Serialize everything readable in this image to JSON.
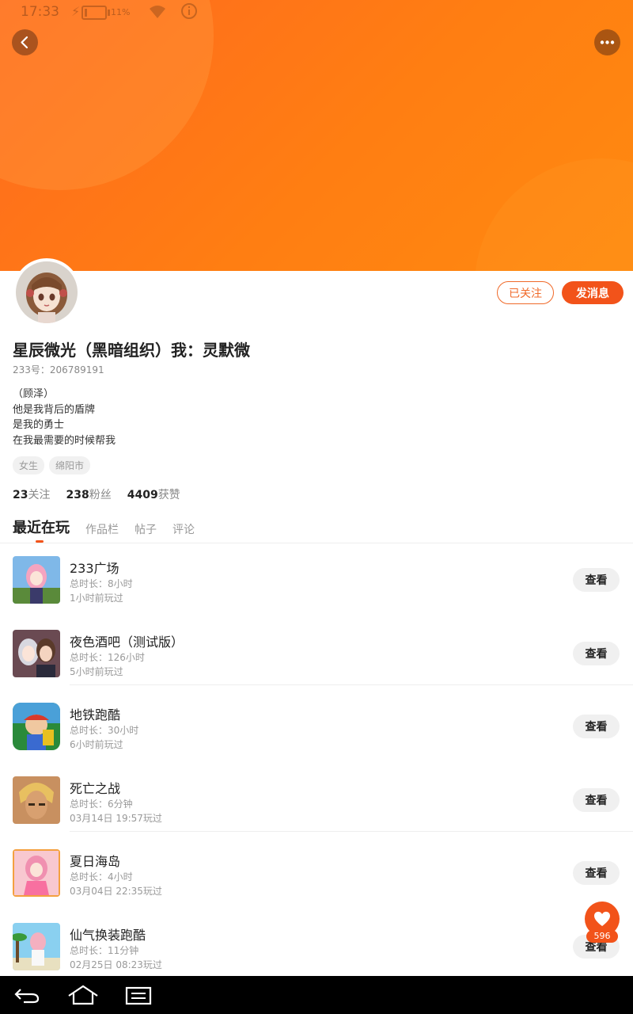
{
  "status_bar": {
    "time": "17:33",
    "battery_pct": "11%",
    "battery_level": 0.11
  },
  "header": {
    "back_icon": "chevron-left-icon",
    "more_icon": "more-dots-icon"
  },
  "profile": {
    "name": "星辰微光（黑暗组织）我：灵默微",
    "uid": "233号：206789191",
    "bio": [
      "（顾泽）",
      "他是我背后的盾牌",
      "是我的勇士",
      "在我最需要的时候帮我"
    ],
    "tags": [
      "女生",
      "绵阳市"
    ],
    "follow_label": "已关注",
    "message_label": "发消息",
    "stats": [
      {
        "num": "23",
        "label": "关注"
      },
      {
        "num": "238",
        "label": "粉丝"
      },
      {
        "num": "4409",
        "label": "获赞"
      }
    ]
  },
  "tabs": [
    "最近在玩",
    "作品栏",
    "帖子",
    "评论"
  ],
  "games": [
    {
      "title": "233广场",
      "duration": "总时长：8小时",
      "last_played": "1小时前玩过",
      "button": "查看"
    },
    {
      "title": "夜色酒吧（测试版）",
      "duration": "总时长：126小时",
      "last_played": "5小时前玩过",
      "button": "查看"
    },
    {
      "title": "地铁跑酷",
      "duration": "总时长：30小时",
      "last_played": "6小时前玩过",
      "button": "查看"
    },
    {
      "title": "死亡之战",
      "duration": "总时长：6分钟",
      "last_played": "03月14日 19:57玩过",
      "button": "查看"
    },
    {
      "title": "夏日海岛",
      "duration": "总时长：4小时",
      "last_played": "03月04日 22:35玩过",
      "button": "查看"
    },
    {
      "title": "仙气换装跑酷",
      "duration": "总时长：11分钟",
      "last_played": "02月25日 08:23玩过",
      "button": "查看"
    }
  ],
  "fab": {
    "icon": "heart-icon",
    "count": "596"
  },
  "colors": {
    "accent": "#f2531a",
    "header": "#ff7a15"
  }
}
